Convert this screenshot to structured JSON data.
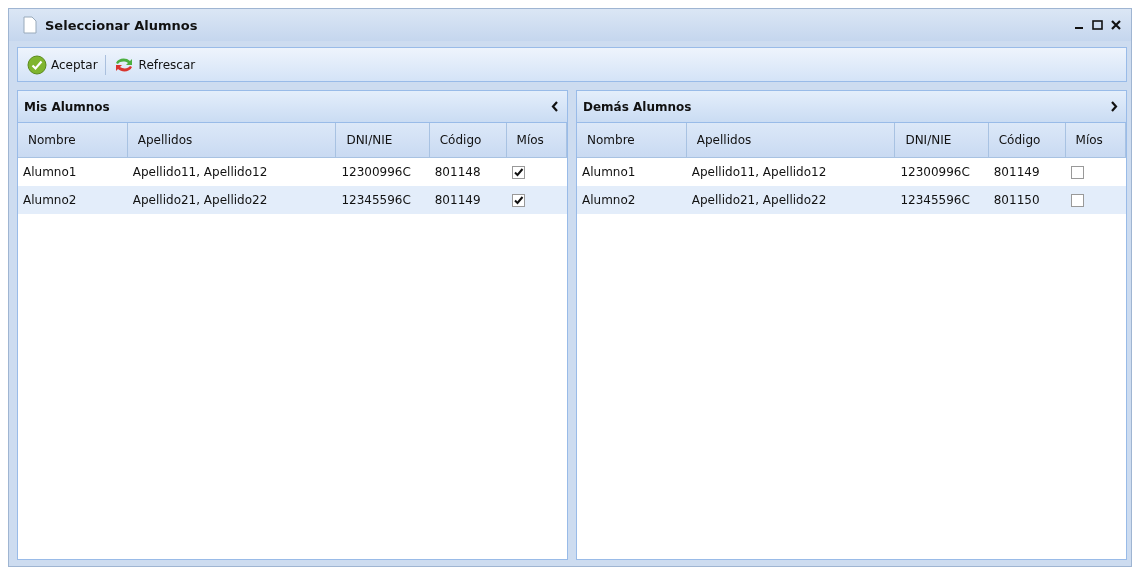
{
  "window": {
    "title": "Seleccionar Alumnos"
  },
  "toolbar": [
    {
      "kind": "accept",
      "label": "Aceptar"
    },
    {
      "kind": "refresh",
      "label": "Refrescar"
    }
  ],
  "panels": [
    {
      "title": "Mis Alumnos",
      "kind": "left",
      "columns": [
        "Nombre",
        "Apellidos",
        "DNI/NIE",
        "Código",
        "Míos"
      ],
      "rows": [
        {
          "nombre": "Alumno1",
          "apellidos": "Apellido11, Apellido12",
          "dni": "12300996C",
          "codigo": "801148",
          "checked": true
        },
        {
          "nombre": "Alumno2",
          "apellidos": "Apellido21, Apellido22",
          "dni": "12345596C",
          "codigo": "801149",
          "checked": true
        }
      ]
    },
    {
      "title": "Demás Alumnos",
      "kind": "right",
      "columns": [
        "Nombre",
        "Apellidos",
        "DNI/NIE",
        "Código",
        "Míos"
      ],
      "rows": [
        {
          "nombre": "Alumno1",
          "apellidos": "Apellido11, Apellido12",
          "dni": "12300996C",
          "codigo": "801149",
          "checked": false
        },
        {
          "nombre": "Alumno2",
          "apellidos": "Apellido21, Apellido22",
          "dni": "12345596C",
          "codigo": "801150",
          "checked": false
        }
      ]
    }
  ]
}
